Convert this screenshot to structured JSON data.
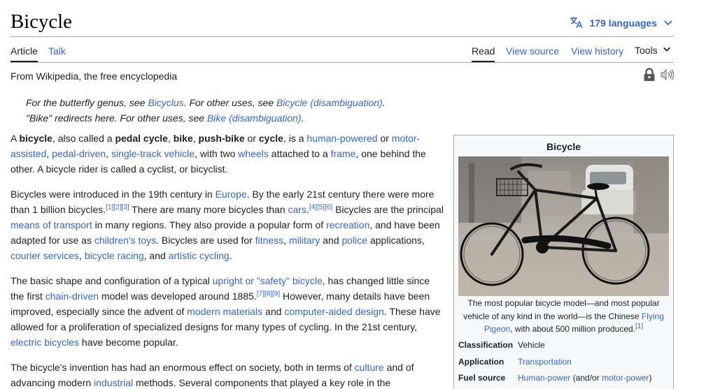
{
  "page": {
    "title": "Bicycle",
    "languages_label": "179 languages"
  },
  "tabs": {
    "article": "Article",
    "talk": "Talk",
    "read": "Read",
    "view_source": "View source",
    "view_history": "View history",
    "tools": "Tools"
  },
  "tagline": "From Wikipedia, the free encyclopedia",
  "hatnotes": {
    "line1_pre": "For the butterfly genus, see ",
    "line1_link1": "Bicyclus",
    "line1_mid": ". For other uses, see ",
    "line1_link2": "Bicycle (disambiguation)",
    "line1_end": ".",
    "line2_pre": "\"Bike\" redirects here. For other uses, see ",
    "line2_link": "Bike (disambiguation)",
    "line2_end": "."
  },
  "paragraphs": {
    "p1": {
      "t0": "A ",
      "b1": "bicycle",
      "t1": ", also called a ",
      "b2": "pedal cycle",
      "t2": ", ",
      "b3": "bike",
      "t3": ", ",
      "b4": "push-bike",
      "t4": " or ",
      "b5": "cycle",
      "t5": ", is a ",
      "l1": "human-powered",
      "t6": " or ",
      "l2": "motor-assisted",
      "t7": ", ",
      "l3": "pedal-driven",
      "t8": ", ",
      "l4": "single-track vehicle",
      "t9": ", with two ",
      "l5": "wheels",
      "t10": " attached to a ",
      "l6": "frame",
      "t11": ", one behind the other. A bicycle rider is called a cyclist, or bicyclist."
    },
    "p2": {
      "t0": "Bicycles were introduced in the 19th century in ",
      "l1": "Europe",
      "t1": ". By the early 21st century there were more than 1 billion bicycles.",
      "s1": "[1][2][3]",
      "t2": " There are many more bicycles than ",
      "l2": "cars",
      "t3": ".",
      "s2": "[4][5][6]",
      "t4": " Bicycles are the principal ",
      "l3": "means of transport",
      "t5": " in many regions. They also provide a popular form of ",
      "l4": "recreation",
      "t6": ", and have been adapted for use as ",
      "l5": "children's toys",
      "t7": ". Bicycles are used for ",
      "l6": "fitness",
      "t8": ", ",
      "l7": "military",
      "t9": " and ",
      "l8": "police",
      "t10": " applications, ",
      "l9": "courier services",
      "t11": ", ",
      "l10": "bicycle racing",
      "t12": ", and ",
      "l11": "artistic cycling",
      "t13": "."
    },
    "p3": {
      "t0": "The basic shape and configuration of a typical ",
      "l1": "upright or \"safety\" bicycle",
      "t1": ", has changed little since the first ",
      "l2": "chain-driven",
      "t2": " model was developed around 1885.",
      "s1": "[7][8][9]",
      "t3": " However, many details have been improved, especially since the advent of ",
      "l3": "modern materials",
      "t4": " and ",
      "l4": "computer-aided design",
      "t5": ". These have allowed for a proliferation of specialized designs for many types of cycling. In the 21st century, ",
      "l5": "electric bicycles",
      "t6": " have become popular."
    },
    "p4": {
      "t0": "The bicycle's invention has had an enormous effect on society, both in terms of ",
      "l1": "culture",
      "t1": " and of advancing modern ",
      "l2": "industrial",
      "t2": " methods. Several components that played a key role in the"
    }
  },
  "infobox": {
    "title": "Bicycle",
    "caption_pre": "The most popular bicycle model—and most popular vehicle of any kind in the world—is the Chinese ",
    "caption_link": "Flying Pigeon",
    "caption_post": ", with about 500 million produced.",
    "caption_sup": "[1]",
    "rows": [
      {
        "label": "Classification",
        "value": "Vehicle"
      },
      {
        "label": "Application",
        "value": "Transportation"
      },
      {
        "label": "Fuel source",
        "value_link1": "Human-power",
        "value_mid": " (and/or ",
        "value_link2": "motor-power",
        "value_end": ")"
      }
    ]
  },
  "colors": {
    "link": "#3366cc",
    "text": "#202122",
    "border": "#a2a9b1",
    "infobox_bg": "#f8f9fa"
  },
  "icons": {
    "language": "translate-icon",
    "dropdown": "chevron-down-icon",
    "protection": "lock-icon",
    "audio": "speaker-icon"
  }
}
